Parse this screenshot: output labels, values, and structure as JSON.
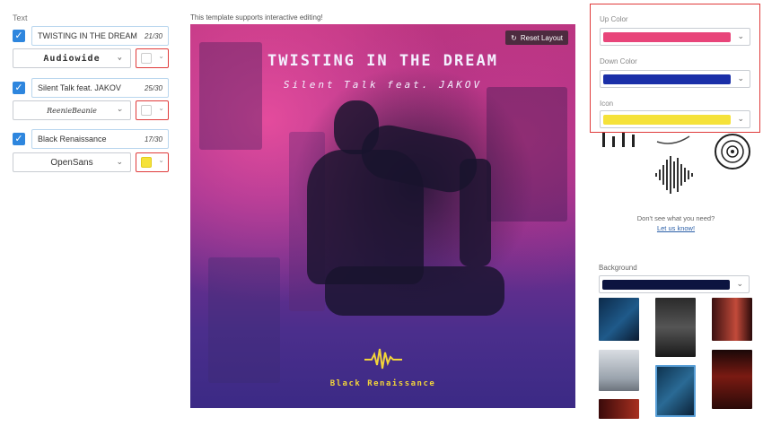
{
  "left": {
    "section_label": "Text",
    "rows": [
      {
        "text": "TWISTING IN THE DREAM",
        "count": "21/30",
        "font": "Audiowide",
        "swatch": "#ffffff"
      },
      {
        "text": "Silent Talk  feat. JAKOV",
        "count": "25/30",
        "font": "ReenieBeanie",
        "swatch": "#ffffff"
      },
      {
        "text": "Black Renaissance",
        "count": "17/30",
        "font": "OpenSans",
        "swatch": "#f5e23a"
      }
    ]
  },
  "center": {
    "hint": "This template supports interactive editing!",
    "reset_label": "Reset Layout",
    "cover_title": "TWISTING IN THE DREAM",
    "cover_subtitle": "Silent Talk feat. JAKOV",
    "cover_artist": "Black Renaissance"
  },
  "right": {
    "up_color_label": "Up Color",
    "up_color": "#e8457a",
    "down_color_label": "Down Color",
    "down_color": "#1a2fa8",
    "icon_label": "Icon",
    "icon_color": "#f5e23a",
    "missing_text": "Don't see what you need?",
    "missing_link": "Let us know!",
    "background_label": "Background",
    "background_color": "#0c1440"
  }
}
